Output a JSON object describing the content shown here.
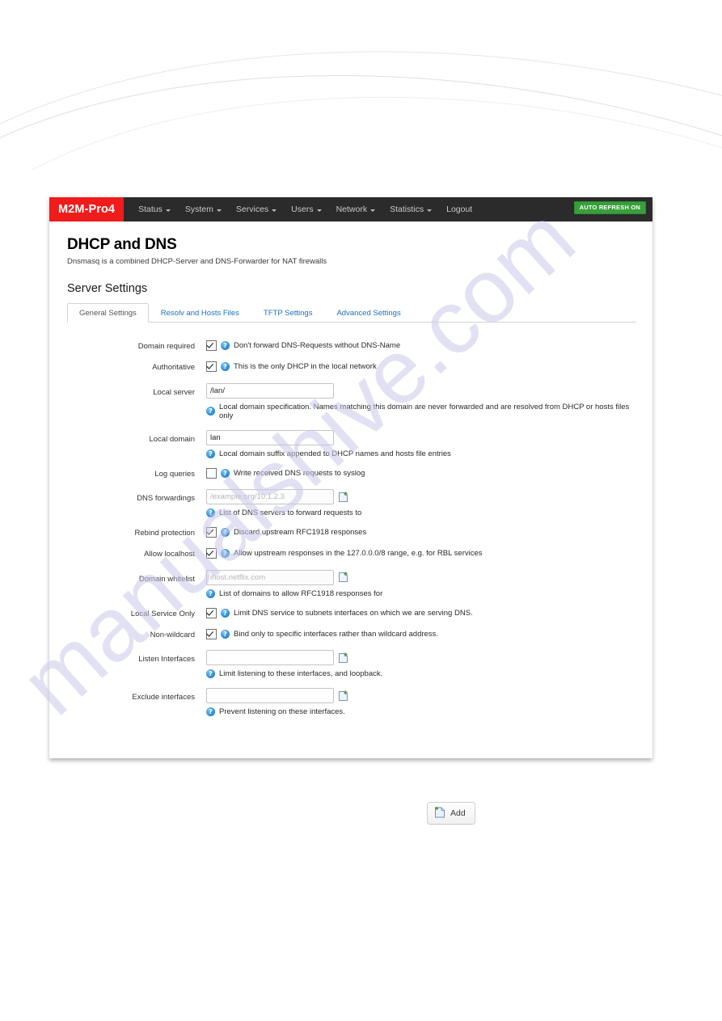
{
  "navbar": {
    "brand": "M2M-Pro4",
    "items": [
      {
        "label": "Status",
        "has_caret": true
      },
      {
        "label": "System",
        "has_caret": true
      },
      {
        "label": "Services",
        "has_caret": true
      },
      {
        "label": "Users",
        "has_caret": true
      },
      {
        "label": "Network",
        "has_caret": true
      },
      {
        "label": "Statistics",
        "has_caret": true
      },
      {
        "label": "Logout",
        "has_caret": false
      }
    ],
    "refresh_badge": "AUTO REFRESH ON",
    "brand_color": "#f01c1c",
    "badge_color": "#38a03a",
    "bar_color": "#2b2b2b"
  },
  "page": {
    "title": "DHCP and DNS",
    "description": "Dnsmasq is a combined DHCP-Server and DNS-Forwarder for NAT firewalls",
    "section_title": "Server Settings"
  },
  "tabs": [
    {
      "label": "General Settings",
      "active": true
    },
    {
      "label": "Resolv and Hosts Files",
      "active": false
    },
    {
      "label": "TFTP Settings",
      "active": false
    },
    {
      "label": "Advanced Settings",
      "active": false
    }
  ],
  "form": {
    "domain_required": {
      "label": "Domain required",
      "checked": true,
      "text": "Don't forward DNS-Requests without DNS-Name"
    },
    "authoritative": {
      "label": "Authoritative",
      "checked": true,
      "text": "This is the only DHCP in the local network"
    },
    "local_server": {
      "label": "Local server",
      "value": "/lan/",
      "placeholder": "",
      "hint": "Local domain specification. Names matching this domain are never forwarded and are resolved from DHCP or hosts files only"
    },
    "local_domain": {
      "label": "Local domain",
      "value": "lan",
      "placeholder": "",
      "hint": "Local domain suffix appended to DHCP names and hosts file entries"
    },
    "log_queries": {
      "label": "Log queries",
      "checked": false,
      "text": "Write received DNS requests to syslog"
    },
    "dns_forwardings": {
      "label": "DNS forwardings",
      "value": "",
      "placeholder": "/example.org/10.1.2.3",
      "hint": "List of DNS servers to forward requests to"
    },
    "rebind_protection": {
      "label": "Rebind protection",
      "checked": true,
      "text": "Discard upstream RFC1918 responses"
    },
    "allow_localhost": {
      "label": "Allow localhost",
      "checked": true,
      "text": "Allow upstream responses in the 127.0.0.0/8 range, e.g. for RBL services"
    },
    "domain_whitelist": {
      "label": "Domain whitelist",
      "value": "",
      "placeholder": "ihost.netflix.com",
      "hint": "List of domains to allow RFC1918 responses for"
    },
    "local_service_only": {
      "label": "Local Service Only",
      "checked": true,
      "text": "Limit DNS service to subnets interfaces on which we are serving DNS."
    },
    "non_wildcard": {
      "label": "Non-wildcard",
      "checked": true,
      "text": "Bind only to specific interfaces rather than wildcard address."
    },
    "listen_interfaces": {
      "label": "Listen Interfaces",
      "value": "",
      "placeholder": "",
      "hint": "Limit listening to these interfaces, and loopback."
    },
    "exclude_interfaces": {
      "label": "Exclude interfaces",
      "value": "",
      "placeholder": "",
      "hint": "Prevent listening on these interfaces."
    }
  },
  "add_button": {
    "label": "Add"
  },
  "help_icon_glyph": "?",
  "watermark": {
    "text": "manualshive.com"
  }
}
